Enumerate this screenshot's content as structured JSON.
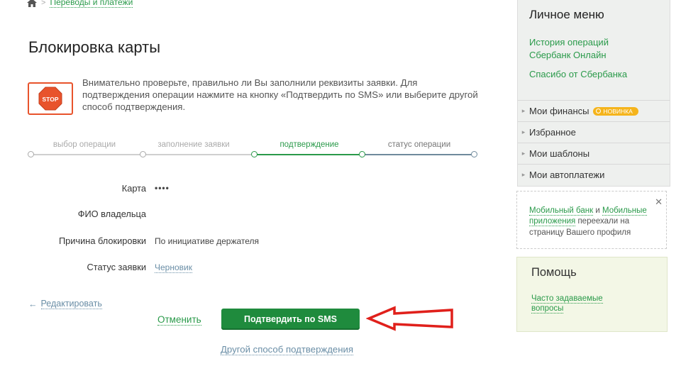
{
  "breadcrumb": {
    "item": "Переводы и платежи"
  },
  "page": {
    "title": "Блокировка карты"
  },
  "notice": {
    "text": "Внимательно проверьте, правильно ли Вы заполнили реквизиты заявки. Для подтверждения операции нажмите на кнопку «Подтвердить по SMS» или выберите другой способ подтверждения.",
    "stop_label": "STOP"
  },
  "steps": [
    {
      "label": "выбор операции",
      "state": "done"
    },
    {
      "label": "заполнение заявки",
      "state": "done"
    },
    {
      "label": "подтверждение",
      "state": "active"
    },
    {
      "label": "статус операции",
      "state": "next"
    }
  ],
  "form": {
    "card_label": "Карта",
    "card_value": "••••",
    "owner_label": "ФИО владельца",
    "owner_value": "",
    "reason_label": "Причина блокировки",
    "reason_value": "По инициативе держателя",
    "status_label": "Статус заявки",
    "status_value": "Черновик"
  },
  "actions": {
    "edit": "Редактировать",
    "cancel": "Отменить",
    "confirm": "Подтвердить по SMS",
    "other": "Другой способ подтверждения"
  },
  "sidebar": {
    "title": "Личное меню",
    "links": [
      "История операций",
      "Сбербанк Онлайн",
      "Спасибо от Сбербанка"
    ],
    "menu": [
      {
        "label": "Мои финансы",
        "badge": "НОВИНКА"
      },
      {
        "label": "Избранное"
      },
      {
        "label": "Мои шаблоны"
      },
      {
        "label": "Мои автоплатежи"
      }
    ],
    "mobile_note": {
      "link1": "Мобильный банк",
      "and": " и ",
      "link2": "Мобильные приложения",
      "rest": " переехали на страницу Вашего профиля"
    },
    "help": {
      "title": "Помощь",
      "link": "Часто задаваемые вопросы"
    }
  },
  "colors": {
    "accent": "#1f8b3d",
    "link": "#2a9a4a",
    "stop": "#e8532c",
    "arrow": "#e0201b"
  }
}
